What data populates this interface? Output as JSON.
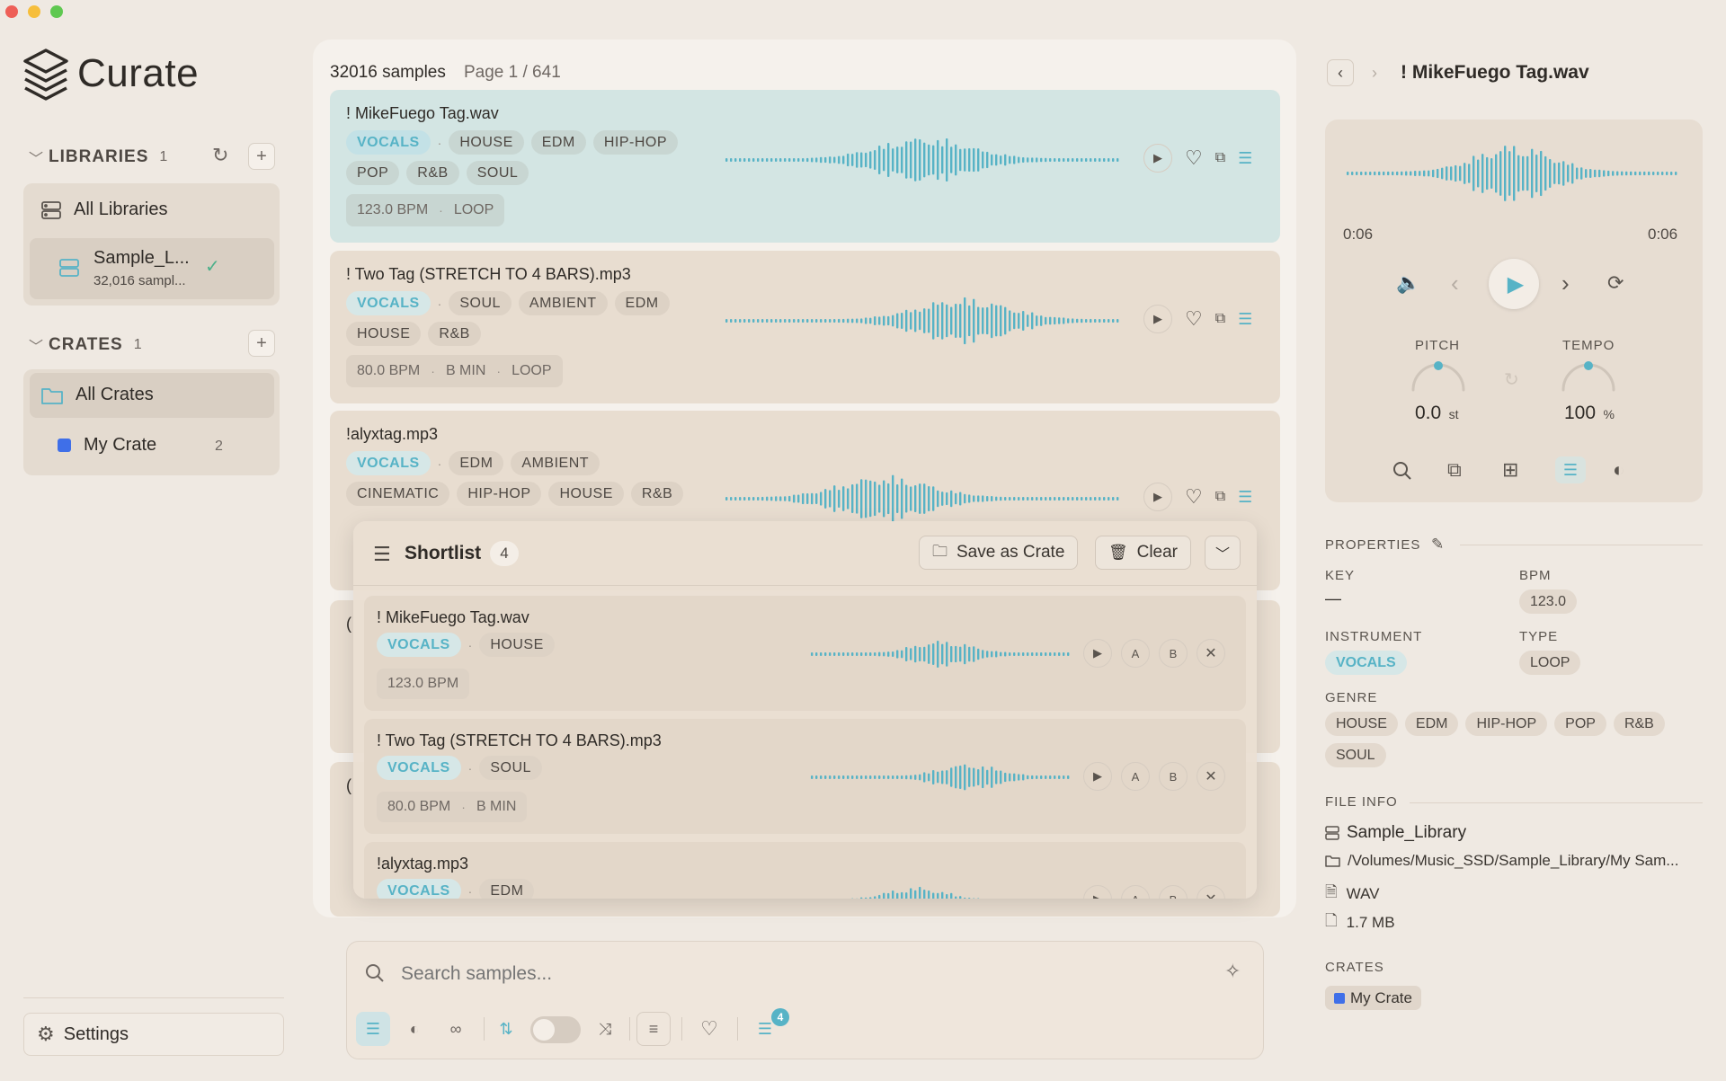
{
  "app": {
    "name": "Curate"
  },
  "sidebar": {
    "libraries": {
      "title": "LIBRARIES",
      "count": "1",
      "all_label": "All Libraries",
      "item_name": "Sample_L...",
      "item_sub": "32,016 sampl..."
    },
    "crates": {
      "title": "CRATES",
      "count": "1",
      "all_label": "All Crates",
      "item_name": "My Crate",
      "item_count": "2",
      "item_color": "#3f6fe8"
    },
    "settings_label": "Settings"
  },
  "list": {
    "count_label": "32016 samples",
    "page_label": "Page 1 / 641",
    "rows": [
      {
        "title": "! MikeFuego Tag.wav",
        "inst": "VOCALS",
        "genres1": [
          "HOUSE",
          "EDM",
          "HIP-HOP"
        ],
        "genres2": [
          "POP",
          "R&B",
          "SOUL"
        ],
        "meta": [
          "123.0 BPM",
          "LOOP"
        ]
      },
      {
        "title": "! Two Tag (STRETCH TO 4 BARS).mp3",
        "inst": "VOCALS",
        "genres1": [
          "SOUL",
          "AMBIENT",
          "EDM"
        ],
        "genres2": [
          "HOUSE",
          "R&B"
        ],
        "meta": [
          "80.0 BPM",
          "B MIN",
          "LOOP"
        ]
      },
      {
        "title": "!alyxtag.mp3",
        "inst": "VOCALS",
        "genres1": [
          "EDM",
          "AMBIENT"
        ],
        "genres2": [
          "CINEMATIC",
          "HIP-HOP",
          "HOUSE",
          "R&B"
        ],
        "meta": []
      }
    ],
    "hidden_rows": [
      {
        "initial": "("
      },
      {
        "initial": "("
      }
    ]
  },
  "shortlist": {
    "title": "Shortlist",
    "count": "4",
    "save_label": "Save as Crate",
    "clear_label": "Clear",
    "items": [
      {
        "title": "! MikeFuego Tag.wav",
        "inst": "VOCALS",
        "genre": "HOUSE",
        "meta": [
          "123.0 BPM"
        ]
      },
      {
        "title": "! Two Tag (STRETCH TO 4 BARS).mp3",
        "inst": "VOCALS",
        "genre": "SOUL",
        "meta": [
          "80.0 BPM",
          "B MIN"
        ]
      },
      {
        "title": "!alyxtag.mp3",
        "inst": "VOCALS",
        "genre": "EDM",
        "meta": []
      }
    ],
    "ab": [
      "A",
      "B"
    ]
  },
  "search": {
    "placeholder": "Search samples...",
    "shortlist_badge": "4"
  },
  "detail": {
    "title": "! MikeFuego Tag.wav",
    "time_current": "0:06",
    "time_total": "0:06",
    "pitch_label": "PITCH",
    "pitch_value": "0.0",
    "pitch_unit": "st",
    "tempo_label": "TEMPO",
    "tempo_value": "100",
    "tempo_unit": "%",
    "properties_label": "PROPERTIES",
    "key_label": "KEY",
    "key_value": "—",
    "bpm_label": "BPM",
    "bpm_value": "123.0",
    "instrument_label": "INSTRUMENT",
    "instrument_value": "VOCALS",
    "type_label": "TYPE",
    "type_value": "LOOP",
    "genre_label": "GENRE",
    "genres": [
      "HOUSE",
      "EDM",
      "HIP-HOP",
      "POP",
      "R&B",
      "SOUL"
    ],
    "file_info_label": "FILE INFO",
    "library": "Sample_Library",
    "path": "/Volumes/Music_SSD/Sample_Library/My Sam...",
    "format": "WAV",
    "size": "1.7 MB",
    "crates_label": "CRATES",
    "crate_name": "My Crate",
    "crate_color": "#3f6fe8"
  },
  "colors": {
    "accent": "#57b3c6",
    "background": "#efe9e2"
  }
}
